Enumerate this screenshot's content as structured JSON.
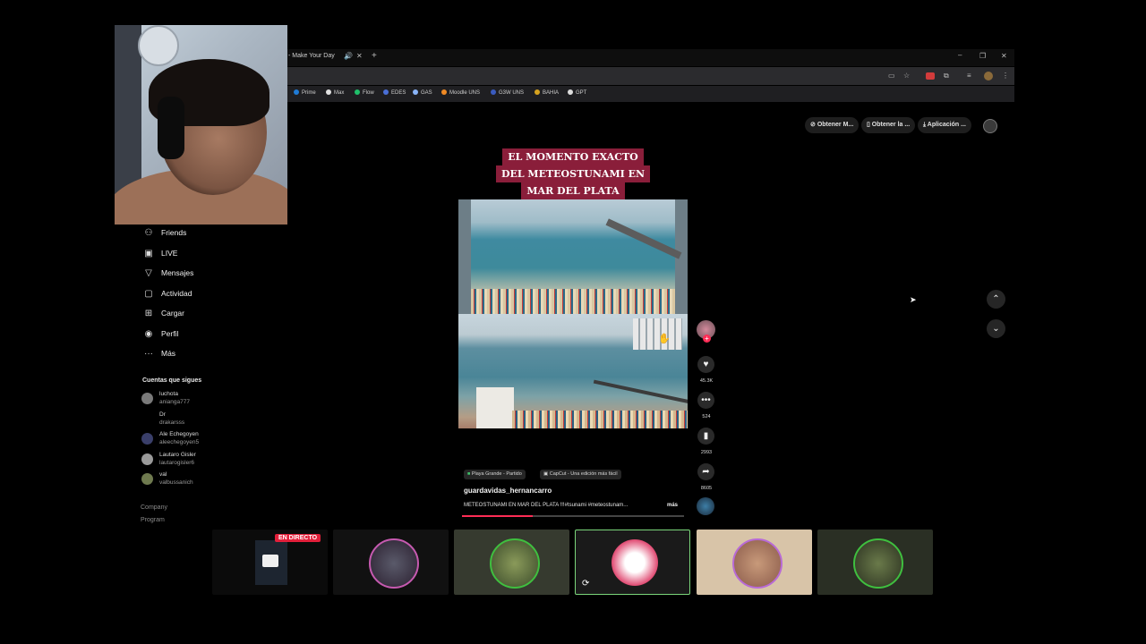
{
  "browser": {
    "tab_title": "- Make Your Day",
    "bookmarks": [
      {
        "label": "Prime",
        "color": "#1f7bd6"
      },
      {
        "label": "Max",
        "color": "#e0e0e0"
      },
      {
        "label": "Flow",
        "color": "#1fbf6a"
      },
      {
        "label": "EDES",
        "color": "#4a6fd6"
      },
      {
        "label": "GAS",
        "color": "#8ab4f8"
      },
      {
        "label": "Moodle UNS",
        "color": "#f08a24"
      },
      {
        "label": "G3W UNS",
        "color": "#3a5bbf"
      },
      {
        "label": "BAHIA",
        "color": "#d6a21f"
      },
      {
        "label": "GPT",
        "color": "#dddddd"
      }
    ]
  },
  "header_actions": {
    "obtain_m": "Obtener M...",
    "obtain_la": "Obtener la ...",
    "app": "Aplicación ..."
  },
  "sidebar": {
    "items": [
      {
        "label": "Friends",
        "icon": "friends-icon"
      },
      {
        "label": "LIVE",
        "icon": "live-icon"
      },
      {
        "label": "Mensajes",
        "icon": "messages-icon"
      },
      {
        "label": "Actividad",
        "icon": "activity-icon"
      },
      {
        "label": "Cargar",
        "icon": "upload-icon"
      },
      {
        "label": "Perfil",
        "icon": "profile-icon"
      },
      {
        "label": "Más",
        "icon": "more-icon"
      }
    ],
    "following_title": "Cuentas que sigues",
    "following": [
      {
        "name": "luchota",
        "handle": "anianga777"
      },
      {
        "name": "Dr",
        "handle": "drakarsss"
      },
      {
        "name": "Ale Echegoyen",
        "handle": "aleechegoyen5"
      },
      {
        "name": "Lautaro Gisler",
        "handle": "lautarogisler6"
      },
      {
        "name": "val",
        "handle": "valbussanich"
      }
    ],
    "footer": {
      "company": "Company",
      "program": "Program"
    }
  },
  "video": {
    "caption_lines": [
      "EL MOMENTO EXACTO",
      "DEL METEOSTUNAMI EN",
      "MAR DEL PLATA"
    ],
    "chip_location": "Playa Grande - Partido",
    "chip_capcut": "CapCut - Una edición más fácil",
    "username": "guardavidas_hernancarro",
    "description": "METEOSTUNAMI EN MAR DEL PLATA !!!#tsunami #meteostunam...",
    "more": "más",
    "progress": 0.32
  },
  "actions": {
    "likes": "45.3K",
    "comments": "524",
    "saves": "2993",
    "shares": "8605"
  },
  "stream": {
    "live_badge": "EN DIRECTO",
    "colors": {
      "accent": "#fe2c55",
      "live": "#e21f3a"
    }
  }
}
